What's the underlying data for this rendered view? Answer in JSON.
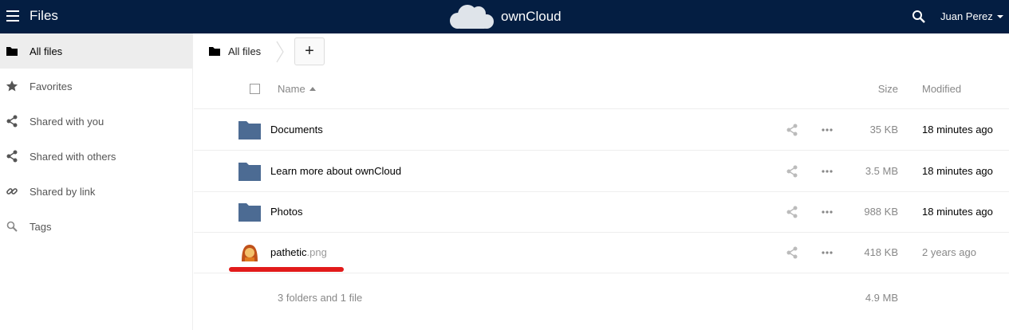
{
  "header": {
    "app_title": "Files",
    "brand_name": "ownCloud",
    "user_name": "Juan Perez",
    "bg_color": "#041e42"
  },
  "sidebar": {
    "items": [
      {
        "label": "All files",
        "icon": "folder-icon",
        "active": true
      },
      {
        "label": "Favorites",
        "icon": "star-icon",
        "active": false
      },
      {
        "label": "Shared with you",
        "icon": "share-icon",
        "active": false
      },
      {
        "label": "Shared with others",
        "icon": "share-icon",
        "active": false
      },
      {
        "label": "Shared by link",
        "icon": "link-icon",
        "active": false
      },
      {
        "label": "Tags",
        "icon": "tag-icon",
        "active": false
      }
    ]
  },
  "breadcrumb": {
    "label": "All files"
  },
  "toolbar": {
    "add_label": "+"
  },
  "table": {
    "headers": {
      "name": "Name",
      "size": "Size",
      "modified": "Modified"
    },
    "rows": [
      {
        "name": "Documents",
        "ext": "",
        "type": "folder",
        "size": "35 KB",
        "modified": "18 minutes ago"
      },
      {
        "name": "Learn more about ownCloud",
        "ext": "",
        "type": "folder",
        "size": "3.5 MB",
        "modified": "18 minutes ago"
      },
      {
        "name": "Photos",
        "ext": "",
        "type": "folder",
        "size": "988 KB",
        "modified": "18 minutes ago"
      },
      {
        "name": "pathetic",
        "ext": ".png",
        "type": "image",
        "size": "418 KB",
        "modified": "2 years ago"
      }
    ],
    "summary": {
      "text": "3 folders and 1 file",
      "size": "4.9 MB"
    }
  },
  "colors": {
    "folder": "#4c6b93",
    "highlight": "#e21b1b"
  }
}
